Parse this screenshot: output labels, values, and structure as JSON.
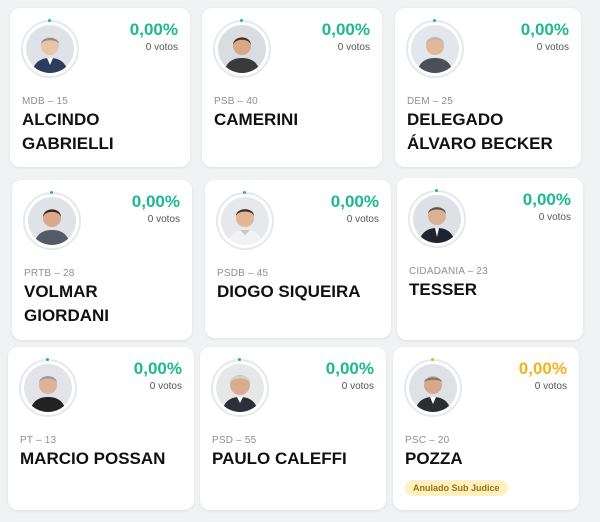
{
  "accent_green": "#1db88e",
  "accent_orange": "#f3b21b",
  "candidates": [
    {
      "party": "MDB – 15",
      "name": "ALCINDO GABRIELLI",
      "percent": "0,00%",
      "votes": "0 votos",
      "photo_icon": "candidate-photo"
    },
    {
      "party": "PSB – 40",
      "name": "CAMERINI",
      "percent": "0,00%",
      "votes": "0 votos",
      "photo_icon": "candidate-photo"
    },
    {
      "party": "DEM – 25",
      "name": "DELEGADO ÁLVARO BECKER",
      "percent": "0,00%",
      "votes": "0 votos",
      "photo_icon": "candidate-photo"
    },
    {
      "party": "PRTB – 28",
      "name": "VOLMAR GIORDANI",
      "percent": "0,00%",
      "votes": "0 votos",
      "photo_icon": "candidate-photo"
    },
    {
      "party": "PSDB – 45",
      "name": "DIOGO SIQUEIRA",
      "percent": "0,00%",
      "votes": "0 votos",
      "photo_icon": "candidate-photo"
    },
    {
      "party": "CIDADANIA – 23",
      "name": "TESSER",
      "percent": "0,00%",
      "votes": "0 votos",
      "photo_icon": "candidate-photo"
    },
    {
      "party": "PT – 13",
      "name": "MARCIO POSSAN",
      "percent": "0,00%",
      "votes": "0 votos",
      "photo_icon": "candidate-photo"
    },
    {
      "party": "PSD – 55",
      "name": "PAULO CALEFFI",
      "percent": "0,00%",
      "votes": "0 votos",
      "photo_icon": "candidate-photo"
    },
    {
      "party": "PSC – 20",
      "name": "POZZA",
      "percent": "0,00%",
      "votes": "0 votos",
      "photo_icon": "candidate-photo",
      "badge": "Anulado Sub Judice"
    }
  ]
}
